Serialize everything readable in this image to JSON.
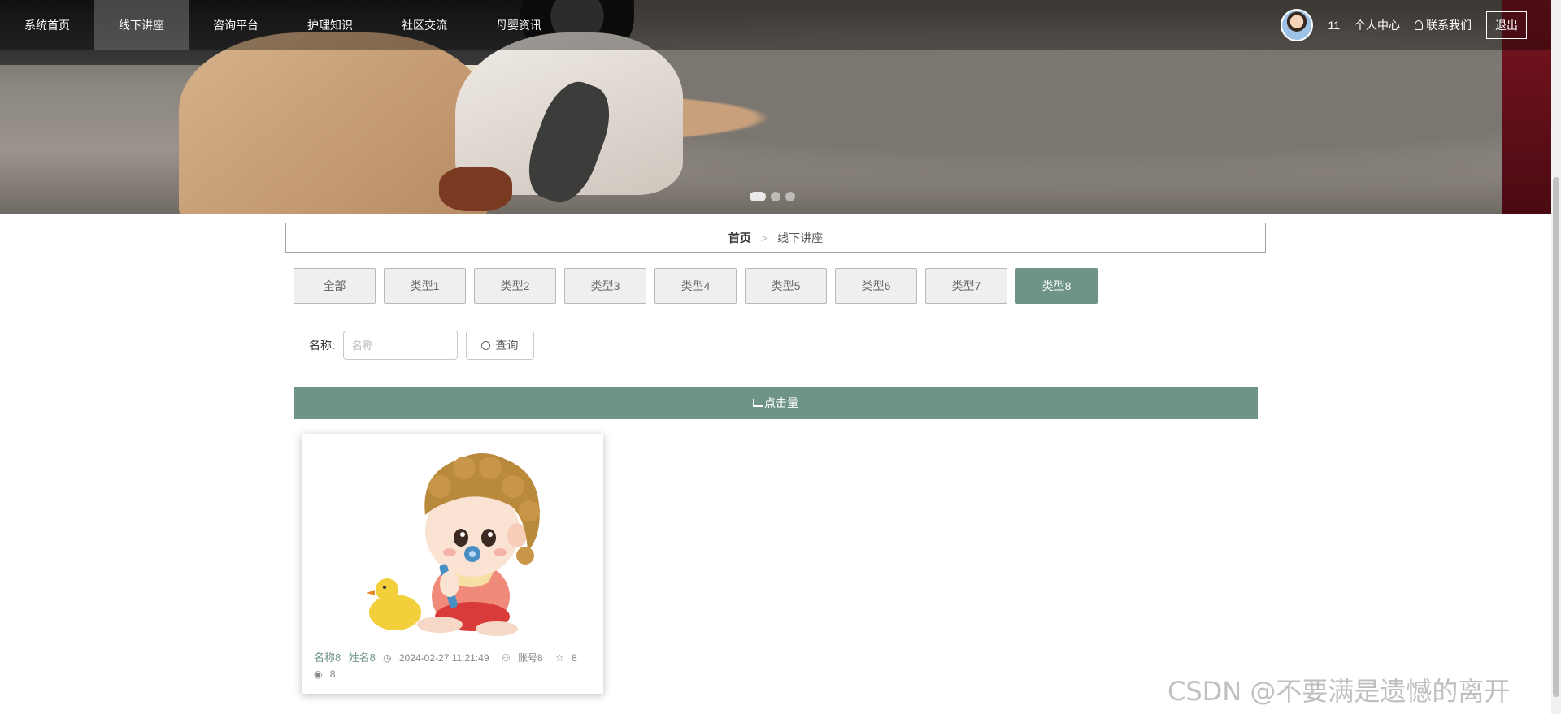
{
  "nav": {
    "items": [
      {
        "label": "系统首页"
      },
      {
        "label": "线下讲座"
      },
      {
        "label": "咨询平台"
      },
      {
        "label": "护理知识"
      },
      {
        "label": "社区交流"
      },
      {
        "label": "母婴资讯"
      }
    ],
    "active_index": 1,
    "user_name": "11",
    "personal_center": "个人中心",
    "contact_us": "联系我们",
    "logout": "退出"
  },
  "breadcrumb": {
    "home": "首页",
    "separator": ">",
    "current": "线下讲座"
  },
  "tabs": {
    "items": [
      "全部",
      "类型1",
      "类型2",
      "类型3",
      "类型4",
      "类型5",
      "类型6",
      "类型7",
      "类型8"
    ],
    "active_index": 8
  },
  "search": {
    "label": "名称:",
    "placeholder": "名称",
    "button": "查询"
  },
  "sortbar": {
    "label": "点击量"
  },
  "card": {
    "name": "名称8",
    "author": "姓名8",
    "datetime": "2024-02-27 11:21:49",
    "account": "账号8",
    "likes": "8",
    "views": "8"
  },
  "watermark": "CSDN @不要满是遗憾的离开",
  "colors": {
    "accent": "#6e9389",
    "nav_bg": "rgba(0,0,0,0.35)"
  }
}
